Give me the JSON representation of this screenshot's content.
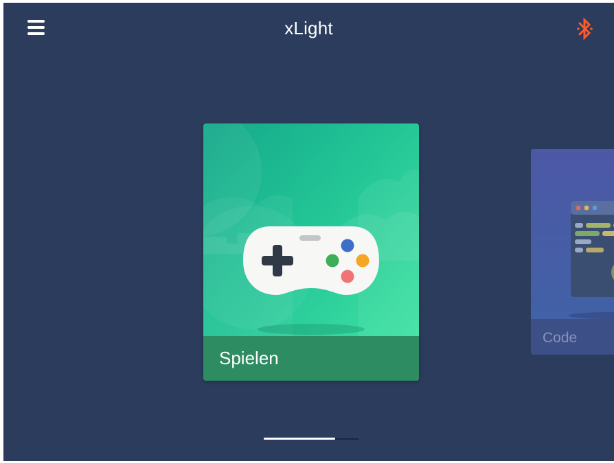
{
  "header": {
    "title": "xLight",
    "menu_icon": "hamburger-menu-icon",
    "bluetooth_icon": "bluetooth-icon",
    "bluetooth_color": "#ff5a2a"
  },
  "cards": [
    {
      "label": "Spielen",
      "icon": "gamepad-illustration",
      "active": true
    },
    {
      "label": "Code",
      "icon": "code-editor-illustration",
      "active": false
    }
  ],
  "pager": {
    "pages": 4,
    "progress": 0.75
  },
  "colors": {
    "background": "#2c3c5c",
    "card_caption_active": "#2e8c63",
    "card_caption_inactive": "#3c4f87"
  }
}
